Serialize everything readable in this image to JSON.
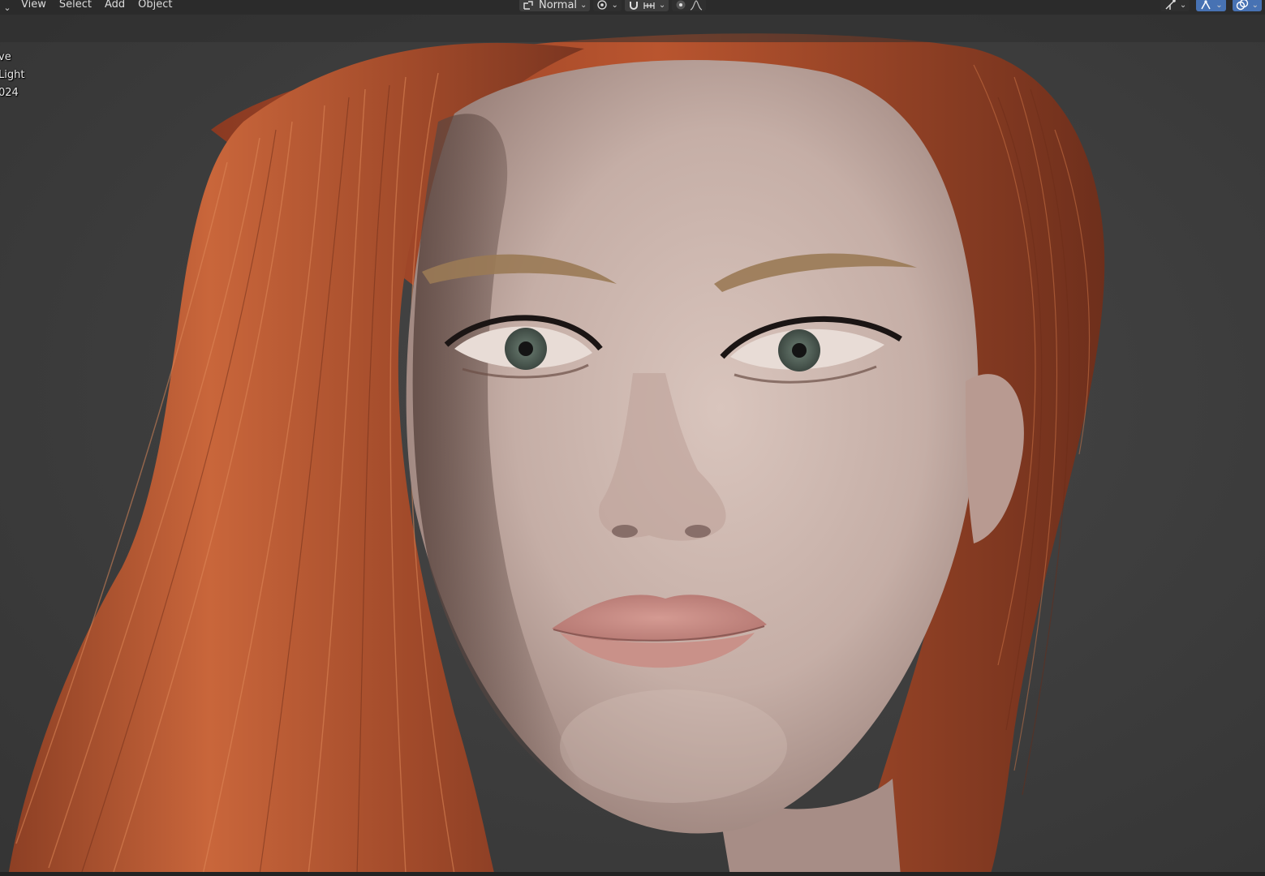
{
  "header": {
    "editor_chevron": "⌄",
    "menu": [
      "View",
      "Select",
      "Add",
      "Object"
    ],
    "orientation_label": "Normal",
    "orientation_icon": "transform-orientation-icon",
    "pivot_icon": "pivot-point-icon",
    "snap_icon": "snap-magnet-icon",
    "snap_increment_icon": "snap-increment-icon",
    "proportional_icon": "proportional-editing-icon",
    "falloff_icon": "falloff-curve-icon",
    "gizmo_icon": "gizmo-icon",
    "overlay_icon": "overlay-icon",
    "xray_icon": "xray-icon"
  },
  "viewport": {
    "overlay_lines": [
      "ve",
      "Light",
      "024"
    ],
    "subject": "3D render of a woman's face with long red hair",
    "colors": {
      "background": "#3a3a3a",
      "hair": "#b8532e",
      "skin": "#c9b3ab",
      "accent": "#4772b3"
    }
  }
}
